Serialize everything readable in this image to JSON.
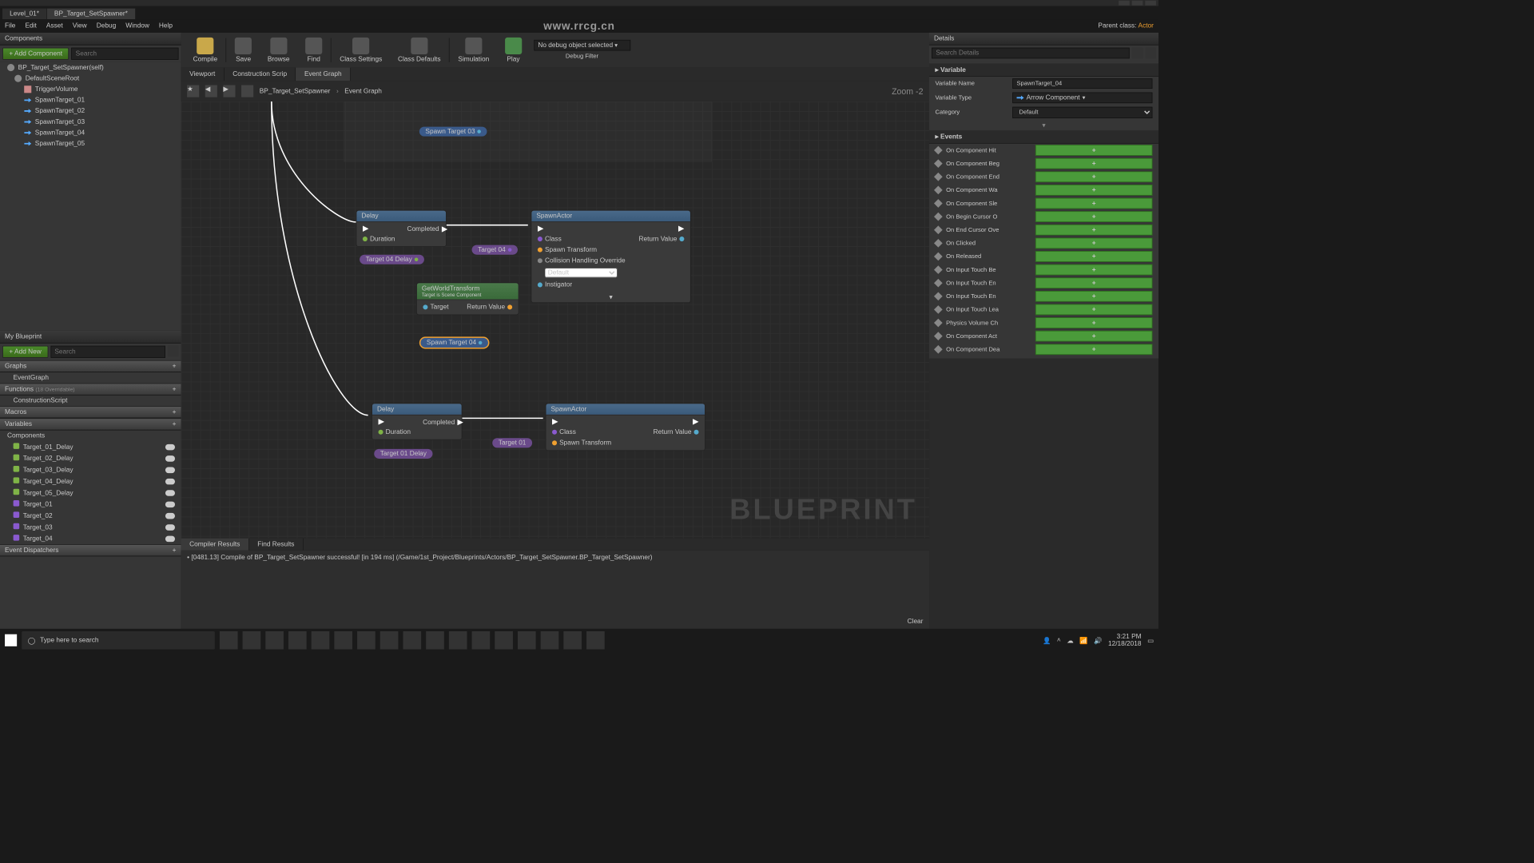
{
  "tabs": {
    "level": "Level_01*",
    "bp": "BP_Target_SetSpawner*"
  },
  "menu": [
    "File",
    "Edit",
    "Asset",
    "View",
    "Debug",
    "Window",
    "Help"
  ],
  "brandUrl": "www.rrcg.cn",
  "parentClass": {
    "label": "Parent class:",
    "value": "Actor"
  },
  "components": {
    "title": "Components",
    "addLabel": "+ Add Component",
    "searchPlaceholder": "Search",
    "root": "BP_Target_SetSpawner(self)",
    "items": [
      "DefaultSceneRoot",
      "TriggerVolume",
      "SpawnTarget_01",
      "SpawnTarget_02",
      "SpawnTarget_03",
      "SpawnTarget_04",
      "SpawnTarget_05"
    ]
  },
  "myBlueprint": {
    "title": "My Blueprint",
    "addLabel": "+ Add New",
    "searchPlaceholder": "Search",
    "sections": {
      "graphs": "Graphs",
      "eventGraph": "EventGraph",
      "functions": "Functions",
      "functionsHint": "(18 Overridable)",
      "construction": "ConstructionScript",
      "macros": "Macros",
      "variables": "Variables",
      "components": "Components",
      "dispatchers": "Event Dispatchers"
    },
    "delayVars": [
      "Target_01_Delay",
      "Target_02_Delay",
      "Target_03_Delay",
      "Target_04_Delay",
      "Target_05_Delay"
    ],
    "targetVars": [
      "Target_01",
      "Target_02",
      "Target_03",
      "Target_04"
    ]
  },
  "toolbar": {
    "compile": "Compile",
    "save": "Save",
    "browse": "Browse",
    "find": "Find",
    "classSettings": "Class Settings",
    "classDefaults": "Class Defaults",
    "simulation": "Simulation",
    "play": "Play",
    "debugSel": "No debug object selected",
    "debugFilter": "Debug Filter"
  },
  "graphTabs": {
    "viewport": "Viewport",
    "construction": "Construction Scrip",
    "event": "Event Graph"
  },
  "breadcrumb": {
    "bp": "BP_Target_SetSpawner",
    "graph": "Event Graph",
    "zoom": "Zoom -2"
  },
  "nodes": {
    "delay": "Delay",
    "duration": "Duration",
    "completed": "Completed",
    "spawnActor": "SpawnActor",
    "class": "Class",
    "spawnTransform": "Spawn Transform",
    "collision": "Collision Handling Override",
    "collisionVal": "Default",
    "instigator": "Instigator",
    "returnValue": "Return Value",
    "getWorldTransform": "GetWorldTransform",
    "getWorldSub": "Target is Scene Component",
    "target": "Target",
    "pillT04Delay": "Target 04 Delay",
    "pillT04": "Target 04",
    "pillSpawn03": "Spawn Target 03",
    "pillSpawn04": "Spawn Target 04",
    "pillT01": "Target 01",
    "pillT01Delay": "Target 01 Delay"
  },
  "watermark": "BLUEPRINT",
  "bottomTabs": {
    "compiler": "Compiler Results",
    "find": "Find Results"
  },
  "compilerMsg": "[0481.13] Compile of BP_Target_SetSpawner successful! [in 194 ms] (/Game/1st_Project/Blueprints/Actors/BP_Target_SetSpawner.BP_Target_SetSpawner)",
  "clearLabel": "Clear",
  "details": {
    "title": "Details",
    "searchPlaceholder": "Search Details",
    "variable": "Variable",
    "varName": {
      "label": "Variable Name",
      "value": "SpawnTarget_04"
    },
    "varType": {
      "label": "Variable Type",
      "value": "Arrow Component"
    },
    "category": {
      "label": "Category",
      "value": "Default"
    },
    "events": "Events",
    "eventList": [
      "On Component Hit",
      "On Component Beg",
      "On Component End",
      "On Component Wa",
      "On Component Sle",
      "On Begin Cursor O",
      "On End Cursor Ove",
      "On Clicked",
      "On Released",
      "On Input Touch Be",
      "On Input Touch En",
      "On Input Touch En",
      "On Input Touch Lea",
      "Physics Volume Ch",
      "On Component Act",
      "On Component Dea"
    ]
  },
  "taskbar": {
    "search": "Type here to search",
    "time": "3:21 PM",
    "date": "12/18/2018"
  }
}
